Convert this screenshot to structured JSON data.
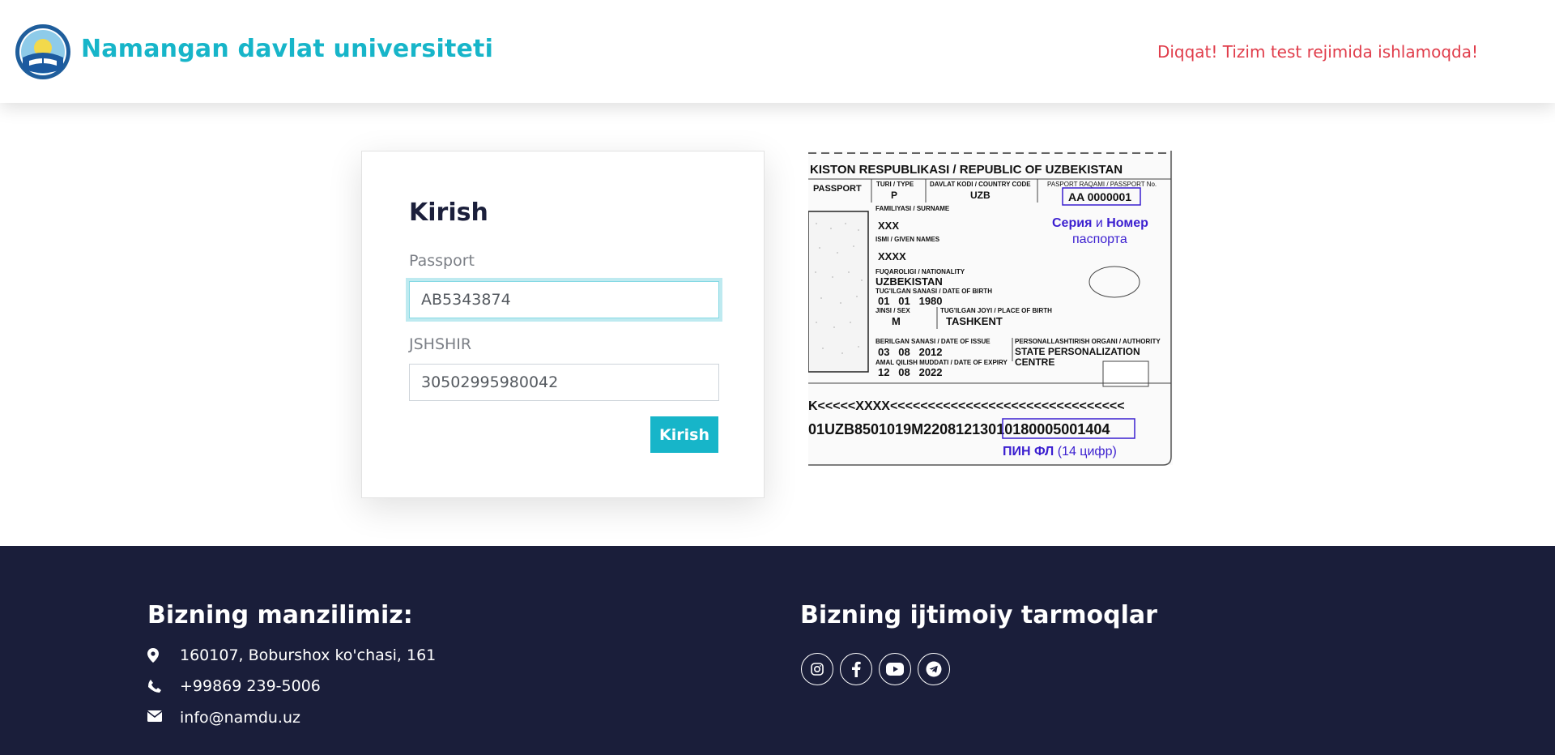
{
  "header": {
    "site_title": "Namangan davlat universiteti",
    "notice": "Diqqat! Tizim test rejimida ishlamoqda!",
    "accent_color": "#17b5c9",
    "notice_color": "#e03c4a"
  },
  "login": {
    "title": "Kirish",
    "passport_label": "Passport",
    "passport_value": "AB5343874",
    "jshshir_label": "JSHSHIR",
    "jshshir_value": "30502995980042",
    "submit_label": "Kirish"
  },
  "passport_sample": {
    "header": "KISTON RESPUBLIKASI / REPUBLIC OF UZBEKISTAN",
    "passport_label": "PASSPORT",
    "type_label": "TURI / TYPE",
    "type_value": "P",
    "country_label": "DAVLAT KODI / COUNTRY CODE",
    "country_value": "UZB",
    "number_label": "PASPORT RAQAMI / PASSPORT No.",
    "number_value": "AA 0000001",
    "surname_label": "FAMILIYASI / SURNAME",
    "surname_value": "XXX",
    "given_label": "ISMI / GIVEN NAMES",
    "given_value": "XXXX",
    "nationality_label": "FUQAROLIGI / NATIONALITY",
    "nationality_value": "UZBEKISTAN",
    "dob_label": "TUG'ILGAN SANASI / DATE OF BIRTH",
    "dob_value": "01   01   1980",
    "sex_label": "JINSI / SEX",
    "sex_value": "M",
    "pob_label": "TUG'ILGAN JOYI / PLACE OF BIRTH",
    "pob_value": "TASHKENT",
    "issue_label": "BERILGAN SANASI / DATE OF ISSUE",
    "issue_value": "03   08   2012",
    "authority_label": "PERSONALLASHTIRISH ORGANI / AUTHORITY",
    "authority_value_1": "STATE PERSONALIZATION",
    "authority_value_2": "CENTRE",
    "expiry_label": "AMAL QILISH MUDDATI / DATE OF EXPIRY",
    "expiry_value": "12   08   2022",
    "series_bold_1": "Серия",
    "series_and": " и ",
    "series_bold_2": "Номер",
    "series_caption": "паспорта",
    "mrz_line_1": "K<<<<<XXXX<<<<<<<<<<<<<<<<<<<<<<<<<<<<<<<",
    "mrz_prefix": "01UZB8501019M2208121",
    "mrz_pin": "30101800050014",
    "mrz_suffix": "04",
    "pin_bold": "ПИН ФЛ",
    "pin_caption": " (14 цифр)",
    "highlight_color": "#3b1fd0"
  },
  "footer": {
    "address_heading": "Bizning manzilimiz:",
    "address": "160107, Boburshox ko'chasi, 161",
    "phone": "+99869 239-5006",
    "email": "info@namdu.uz",
    "social_heading": "Bizning ijtimoiy tarmoqlar",
    "social_icons": [
      "instagram-icon",
      "facebook-icon",
      "youtube-icon",
      "telegram-icon"
    ],
    "background_color": "#1a1e3a"
  }
}
